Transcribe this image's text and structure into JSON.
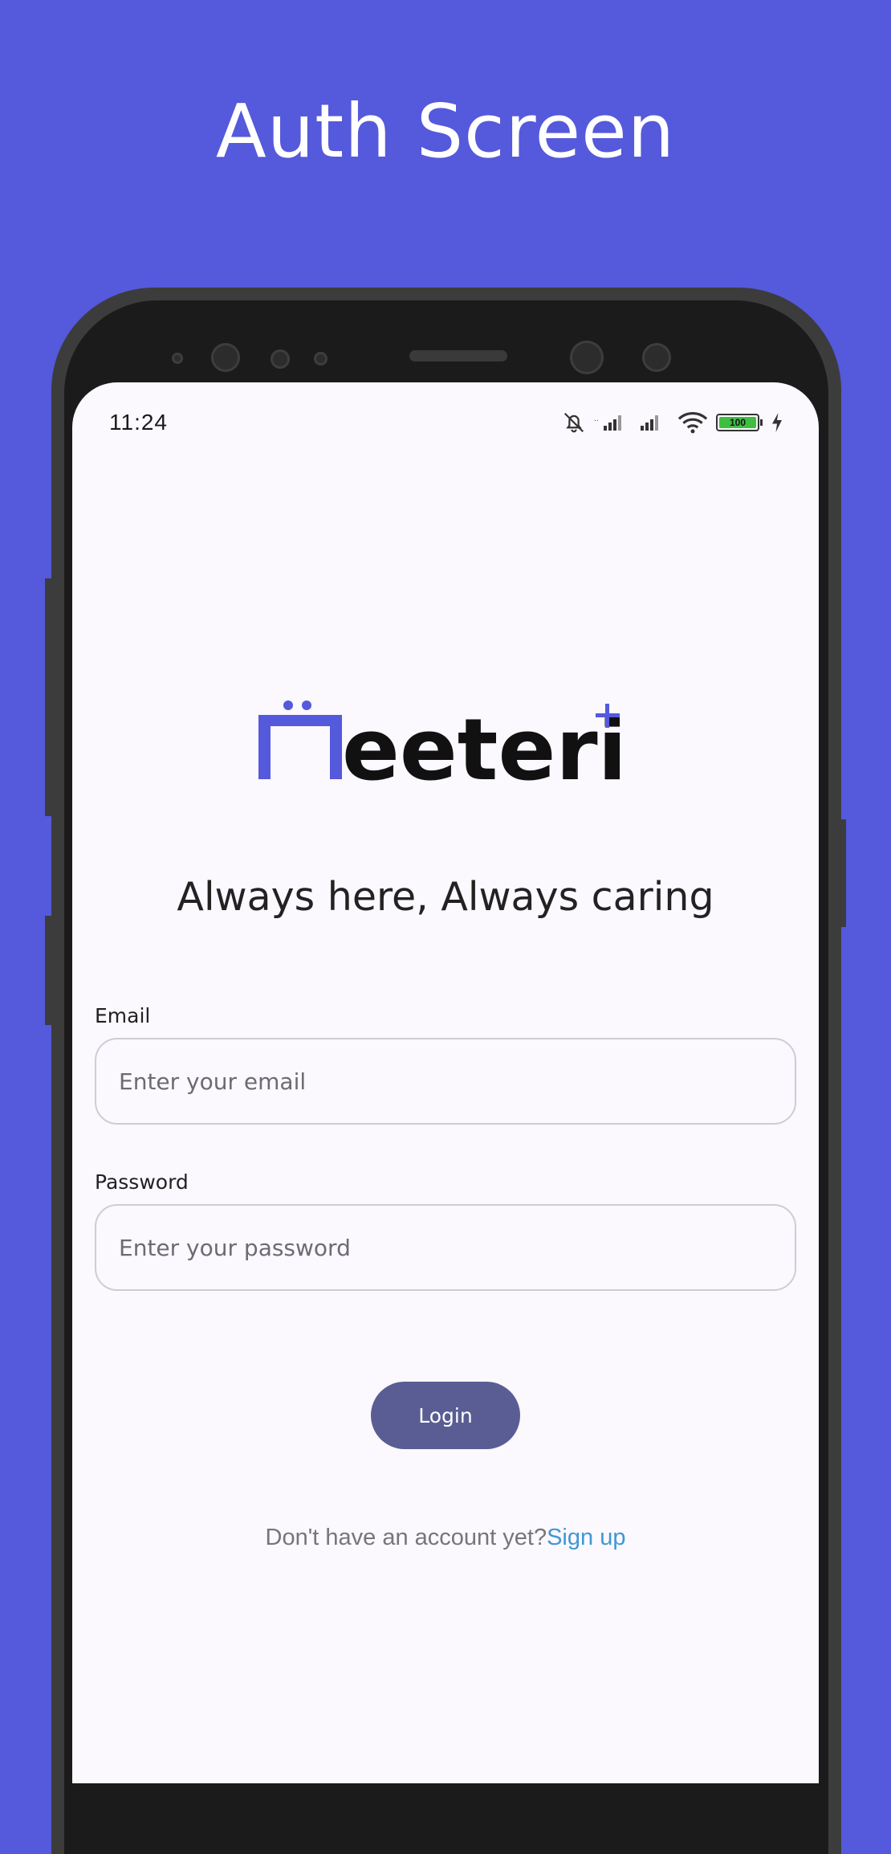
{
  "header": {
    "title": "Auth Screen"
  },
  "status_bar": {
    "time": "11:24",
    "battery": "100",
    "icons": [
      "bell-off-icon",
      "signal-icon",
      "signal-icon",
      "wifi-icon",
      "battery-icon",
      "charging-icon"
    ]
  },
  "brand": {
    "logo_text": "Meeteri",
    "accent_color": "#5559db"
  },
  "tagline": "Always here, Always caring",
  "form": {
    "email_label": "Email",
    "email_placeholder": "Enter your email",
    "password_label": "Password",
    "password_placeholder": "Enter your password",
    "login_label": "Login"
  },
  "footer": {
    "prompt": "Don't have an account yet?",
    "signup_label": "Sign up"
  },
  "colors": {
    "background": "#5559db",
    "screen": "#fbf8fe",
    "button": "#5a5d93",
    "link": "#3d98d5"
  }
}
